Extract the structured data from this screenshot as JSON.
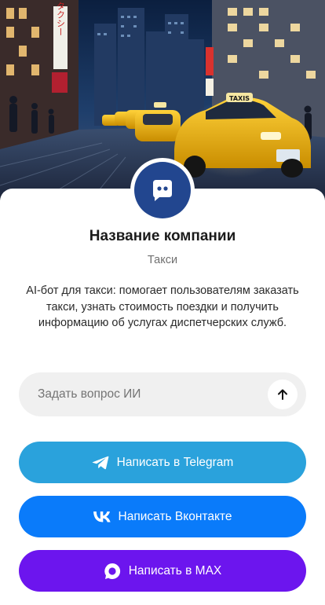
{
  "company": {
    "name": "Название компании",
    "category": "Такси",
    "description": "AI-бот для такси: помогает пользователям заказать такси, узнать стоимость поездки и получить информацию об услугах диспетчерских служб."
  },
  "hero": {
    "sign_left": "タクシー",
    "taxi_sign": "TAXIS"
  },
  "ask": {
    "placeholder": "Задать вопрос ИИ"
  },
  "buttons": {
    "telegram": {
      "label": "Написать в Telegram",
      "color": "#2aa2dc",
      "icon": "telegram-icon"
    },
    "vk": {
      "label": "Написать Вконтакте",
      "color": "#0a7bfa",
      "icon": "vk-icon"
    },
    "max": {
      "label": "Написать в MAX",
      "color": "#6c15ee",
      "icon": "max-icon"
    }
  },
  "colors": {
    "avatar_bg": "#22468f",
    "ask_bg": "#f0f0f0"
  }
}
